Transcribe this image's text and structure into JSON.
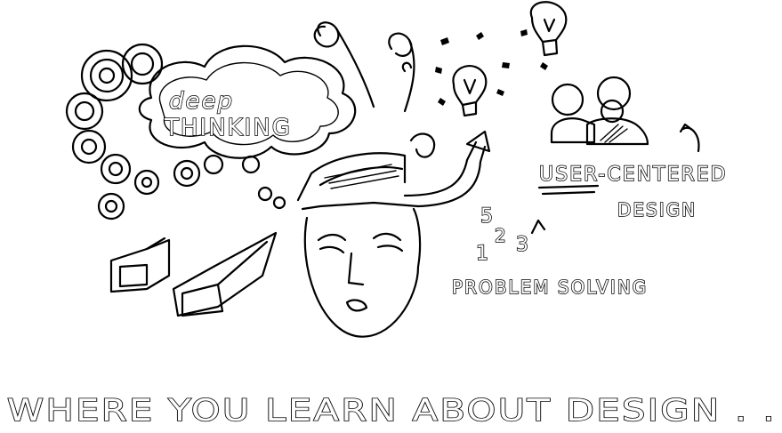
{
  "thought_cloud": {
    "word_1": "deep",
    "word_2": "THINKING"
  },
  "concepts": {
    "user_centered": "USER-CENTERED",
    "design": "DESIGN",
    "problem_solving": "PROBLEM SOLVING",
    "numbers": [
      "1",
      "2",
      "3",
      "5"
    ]
  },
  "tagline": "WHERE YOU LEARN ABOUT DESIGN . ."
}
